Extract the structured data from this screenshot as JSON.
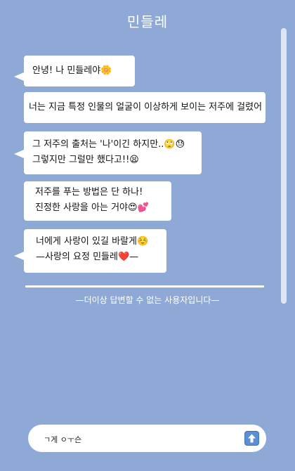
{
  "header": {
    "title": "민들레"
  },
  "messages": [
    {
      "lines": [
        "안녕! 나 민들레야🌼"
      ]
    },
    {
      "lines": [
        "너는 지금 특정 인물의 얼굴이 이상하게 보이는 저주에 걸렸어"
      ]
    },
    {
      "lines": [
        "그 저주의 출처는 '나'이긴 하지만..🙄😓",
        "그렇지만 그럴만 했다고!!😫"
      ]
    },
    {
      "lines": [
        "저주를 푸는 방법은 단 하나!",
        "진정한 사랑을 아는 거야😍💕"
      ]
    },
    {
      "lines": [
        "너에게 사랑이 있길 바랄게☺️",
        "—사랑의 요정 민들레❤️—"
      ]
    }
  ],
  "notice": "—더이상 답변할 수 없는 사용자입니다—",
  "composer": {
    "value": "ㄱ게 ㅇㅜ슨"
  },
  "icons": {
    "send": "up-arrow-icon"
  }
}
